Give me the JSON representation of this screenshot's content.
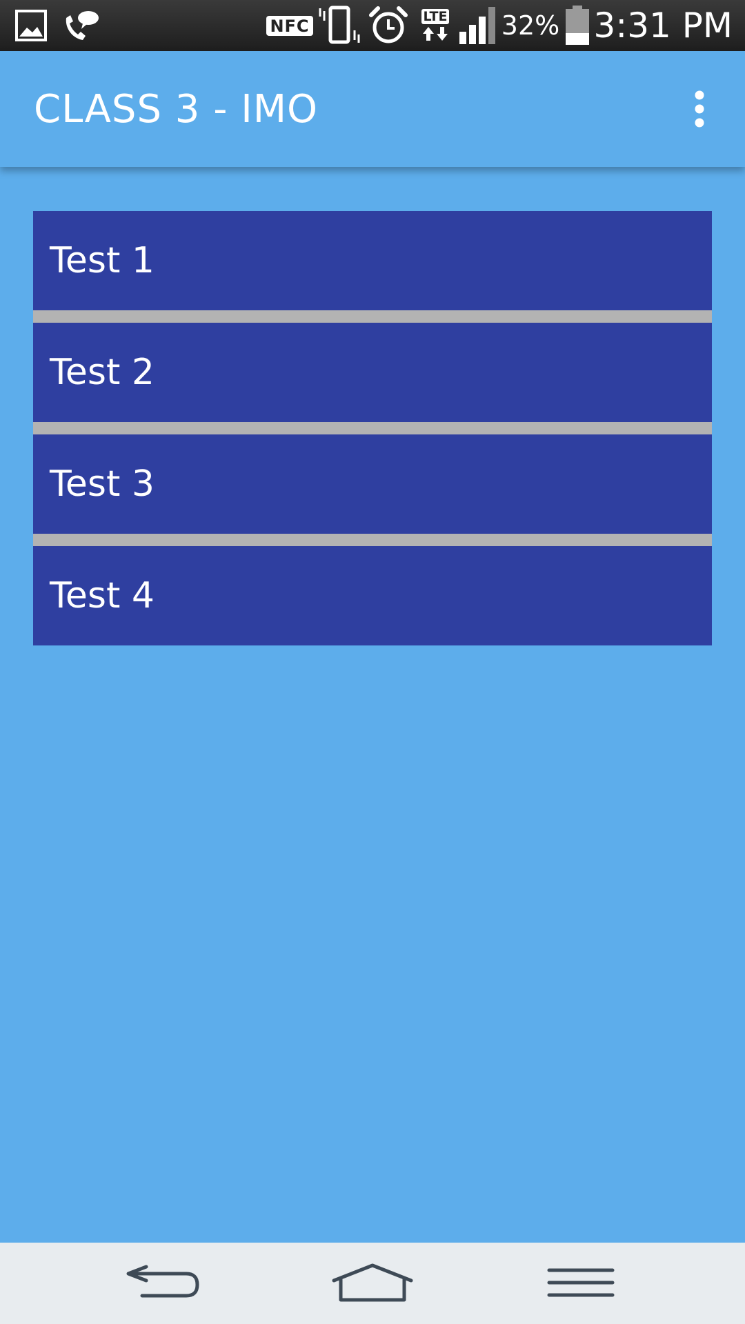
{
  "status_bar": {
    "icons": [
      "gallery-icon",
      "call-chat-icon",
      "nfc-icon",
      "vibrate-icon",
      "alarm-icon",
      "lte-icon",
      "signal-icon",
      "battery-icon"
    ],
    "nfc_label": "NFC",
    "lte_label": "LTE",
    "battery_percent": "32%",
    "battery_level": 0.32,
    "time": "3:31 PM"
  },
  "app_bar": {
    "title": "CLASS 3 - IMO",
    "menu_icon": "overflow-menu-icon"
  },
  "list": {
    "items": [
      {
        "label": "Test 1"
      },
      {
        "label": "Test 2"
      },
      {
        "label": "Test 3"
      },
      {
        "label": "Test 4"
      }
    ]
  },
  "nav_bar": {
    "buttons": [
      "back-icon",
      "home-icon",
      "menu-icon"
    ]
  },
  "colors": {
    "background": "#5dadeb",
    "list_item": "#2f3fa0",
    "divider": "#b3b3b3",
    "nav_bar": "#e8ecef",
    "status_bar": "#262626"
  }
}
